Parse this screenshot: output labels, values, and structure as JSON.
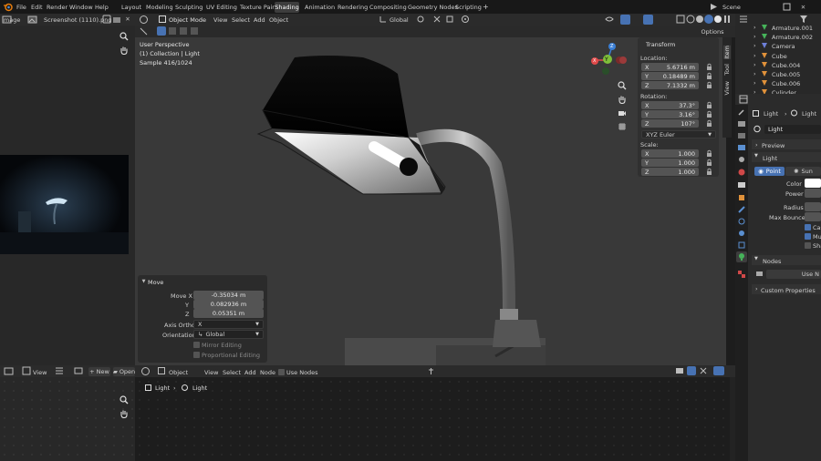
{
  "menubar": {
    "menus": [
      "File",
      "Edit",
      "Render",
      "Window",
      "Help"
    ],
    "workspaces": [
      "Layout",
      "Modeling",
      "Sculpting",
      "UV Editing",
      "Texture Paint",
      "Shading",
      "Animation",
      "Rendering",
      "Compositing",
      "Geometry Nodes",
      "Scripting"
    ],
    "active_workspace": "Shading",
    "add_tab": "+",
    "scene_name": "Scene"
  },
  "image_editor": {
    "filename": "Screenshot (1110).png",
    "menu_image": "Image"
  },
  "viewport": {
    "mode": "Object Mode",
    "menus": [
      "View",
      "Select",
      "Add",
      "Object"
    ],
    "transform_orientation": "Global",
    "options_label": "Options",
    "info_line1": "User Perspective",
    "info_line2": "(1) Collection | Light",
    "info_line3": "Sample 416/1024",
    "side_tabs": [
      "Item",
      "Tool",
      "View"
    ],
    "gizmo_axes": [
      "Z",
      "Y",
      "X"
    ],
    "gizmo_colors": {
      "x": "#e04a4a",
      "y": "#7fbf3a",
      "z": "#3a7fd6"
    }
  },
  "transform_panel": {
    "header": "Transform",
    "location_label": "Location:",
    "location": [
      {
        "axis": "X",
        "value": "5.6716 m"
      },
      {
        "axis": "Y",
        "value": "0.18489 m"
      },
      {
        "axis": "Z",
        "value": "7.1332 m"
      }
    ],
    "rotation_label": "Rotation:",
    "rotation": [
      {
        "axis": "X",
        "value": "37.3°"
      },
      {
        "axis": "Y",
        "value": "3.16°"
      },
      {
        "axis": "Z",
        "value": "107°"
      }
    ],
    "rotation_mode": "XYZ Euler",
    "scale_label": "Scale:",
    "scale": [
      {
        "axis": "X",
        "value": "1.000"
      },
      {
        "axis": "Y",
        "value": "1.000"
      },
      {
        "axis": "Z",
        "value": "1.000"
      }
    ]
  },
  "move_panel": {
    "header": "Move",
    "move_x_label": "Move X",
    "move_x": "-0.35034 m",
    "y_label": "Y",
    "y": "0.082936 m",
    "z_label": "Z",
    "z": "0.05351 m",
    "axis_ortho_label": "Axis Ortho",
    "axis_ortho": "X",
    "orientation_label": "Orientation",
    "orientation": "Global",
    "mirror_editing": "Mirror Editing",
    "proportional_editing": "Proportional Editing"
  },
  "outliner": {
    "items": [
      {
        "name": "Armature.001"
      },
      {
        "name": "Armature.002"
      },
      {
        "name": "Camera"
      },
      {
        "name": "Cube"
      },
      {
        "name": "Cube.004"
      },
      {
        "name": "Cube.005"
      },
      {
        "name": "Cube.006"
      },
      {
        "name": "Cylinder"
      }
    ]
  },
  "properties": {
    "breadcrumb_object": "Light",
    "breadcrumb_data": "Light",
    "data_name": "Light",
    "preview_label": "Preview",
    "light_label": "Light",
    "light_types": [
      "Point",
      "Sun"
    ],
    "active_light_type": "Point",
    "color_label": "Color",
    "power_label": "Power",
    "radius_label": "Radius",
    "max_bounces_label": "Max Bounces",
    "cast_label": "Cast",
    "multi_label": "Mult",
    "shadow_label": "Sha",
    "nodes_label": "Nodes",
    "use_nodes_label": "Use N",
    "custom_props_label": "Custom Properties"
  },
  "node_editor": {
    "view_label": "View",
    "new_label": "New",
    "open_label": "Open",
    "object_label": "Object",
    "menus": [
      "View",
      "Select",
      "Add",
      "Node"
    ],
    "use_nodes_label": "Use Nodes",
    "breadcrumb_object": "Light",
    "breadcrumb_data": "Light"
  }
}
